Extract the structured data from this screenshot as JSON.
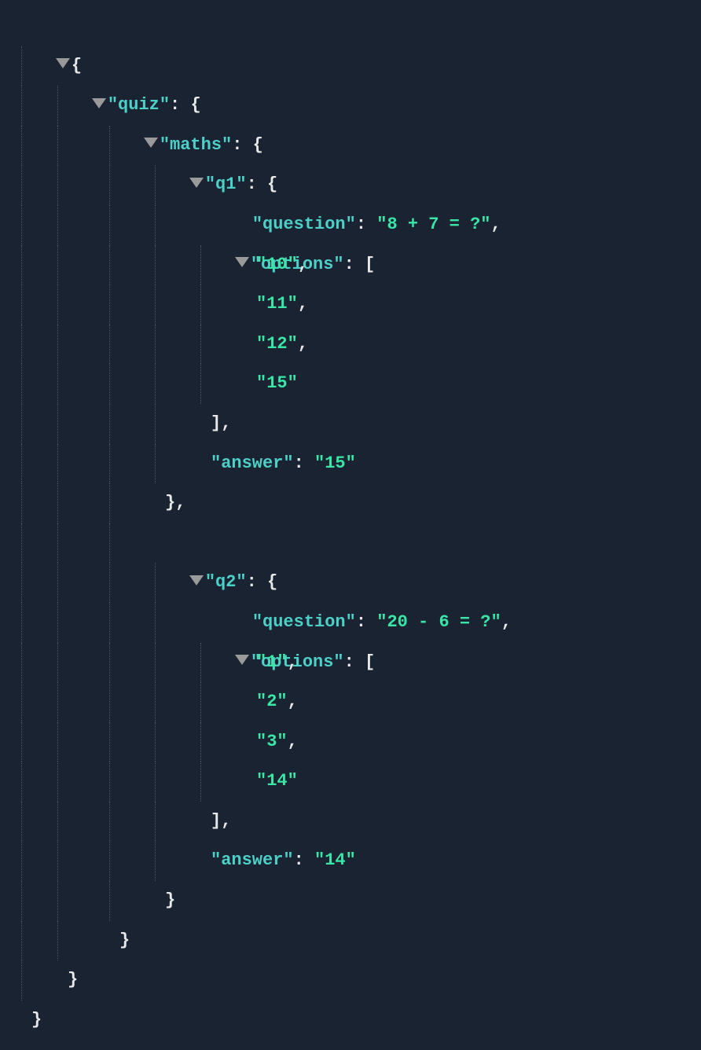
{
  "tree": {
    "open_brace": "{",
    "close_brace": "}",
    "open_bracket": "[",
    "close_bracket": "]",
    "comma": ",",
    "colon": ":",
    "quiz_key": "\"quiz\"",
    "maths_key": "\"maths\"",
    "q1_key": "\"q1\"",
    "q2_key": "\"q2\"",
    "question_key": "\"question\"",
    "options_key": "\"options\"",
    "answer_key": "\"answer\"",
    "q1_question_val": "\"8 + 7 = ?\"",
    "q1_opt0": "\"10\"",
    "q1_opt1": "\"11\"",
    "q1_opt2": "\"12\"",
    "q1_opt3": "\"15\"",
    "q1_answer_val": "\"15\"",
    "q2_question_val": "\"20 - 6 = ?\"",
    "q2_opt0": "\"1\"",
    "q2_opt1": "\"2\"",
    "q2_opt2": "\"3\"",
    "q2_opt3": "\"14\"",
    "q2_answer_val": "\"14\""
  }
}
